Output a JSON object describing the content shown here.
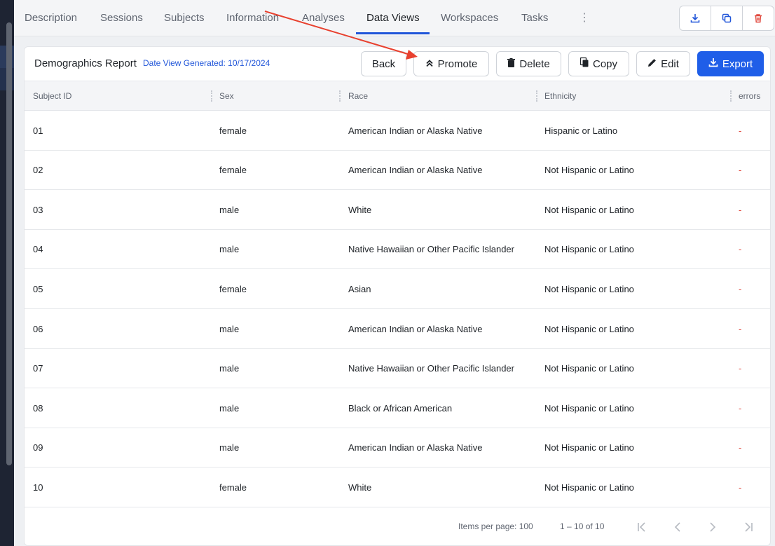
{
  "tabs": [
    {
      "label": "Description"
    },
    {
      "label": "Sessions"
    },
    {
      "label": "Subjects"
    },
    {
      "label": "Information"
    },
    {
      "label": "Analyses"
    },
    {
      "label": "Data Views"
    },
    {
      "label": "Workspaces"
    },
    {
      "label": "Tasks"
    }
  ],
  "tabs_more_icon": "⋮",
  "header_icons": [
    "download-icon",
    "duplicate-icon",
    "trash-icon"
  ],
  "report": {
    "title": "Demographics Report",
    "generated": "Date View Generated: 10/17/2024"
  },
  "actions": {
    "back": "Back",
    "promote": "Promote",
    "delete": "Delete",
    "copy": "Copy",
    "edit": "Edit",
    "export": "Export"
  },
  "table": {
    "columns": [
      "Subject ID",
      "Sex",
      "Race",
      "Ethnicity",
      "errors"
    ],
    "rows": [
      {
        "id": "01",
        "sex": "female",
        "race": "American Indian or Alaska Native",
        "ethnicity": "Hispanic or Latino",
        "errors": "-"
      },
      {
        "id": "02",
        "sex": "female",
        "race": "American Indian or Alaska Native",
        "ethnicity": "Not Hispanic or Latino",
        "errors": "-"
      },
      {
        "id": "03",
        "sex": "male",
        "race": "White",
        "ethnicity": "Not Hispanic or Latino",
        "errors": "-"
      },
      {
        "id": "04",
        "sex": "male",
        "race": "Native Hawaiian or Other Pacific Islander",
        "ethnicity": "Not Hispanic or Latino",
        "errors": "-"
      },
      {
        "id": "05",
        "sex": "female",
        "race": "Asian",
        "ethnicity": "Not Hispanic or Latino",
        "errors": "-"
      },
      {
        "id": "06",
        "sex": "male",
        "race": "American Indian or Alaska Native",
        "ethnicity": "Not Hispanic or Latino",
        "errors": "-"
      },
      {
        "id": "07",
        "sex": "male",
        "race": "Native Hawaiian or Other Pacific Islander",
        "ethnicity": "Not Hispanic or Latino",
        "errors": "-"
      },
      {
        "id": "08",
        "sex": "male",
        "race": "Black or African American",
        "ethnicity": "Not Hispanic or Latino",
        "errors": "-"
      },
      {
        "id": "09",
        "sex": "male",
        "race": "American Indian or Alaska Native",
        "ethnicity": "Not Hispanic or Latino",
        "errors": "-"
      },
      {
        "id": "10",
        "sex": "female",
        "race": "White",
        "ethnicity": "Not Hispanic or Latino",
        "errors": "-"
      }
    ]
  },
  "pagination": {
    "items_per_page": "Items per page: 100",
    "range": "1 – 10 of 10"
  },
  "colors": {
    "accent": "#1f5ee8",
    "link": "#2156d9",
    "error": "#e0473c",
    "annotation_arrow": "#e8412f"
  }
}
